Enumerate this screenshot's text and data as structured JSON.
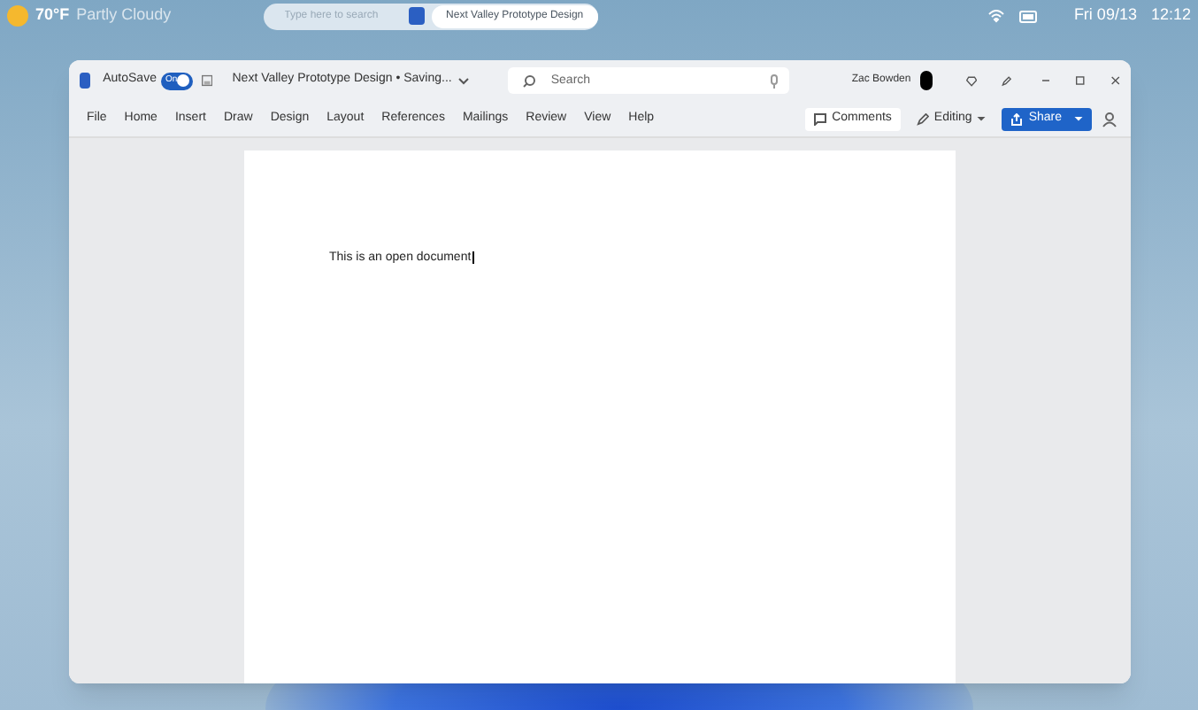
{
  "taskbar": {
    "temperature": "70°F",
    "weather": "Partly Cloudy",
    "search": {
      "placeholder": "Type here to search"
    },
    "open_document": "Next Valley Prototype Design",
    "date": "Fri 09/13",
    "time": "12:12"
  },
  "window": {
    "autosave_label": "AutoSave",
    "autosave": {
      "on": true,
      "label": "On"
    },
    "title": "Next Valley Prototype Design • Saving...",
    "search": {
      "placeholder": "Search"
    },
    "user": "Zac Bowden",
    "menu": [
      {
        "label": "File"
      },
      {
        "label": "Home"
      },
      {
        "label": "Insert"
      },
      {
        "label": "Draw"
      },
      {
        "label": "Design"
      },
      {
        "label": "Layout"
      },
      {
        "label": "References"
      },
      {
        "label": "Mailings"
      },
      {
        "label": "Review"
      },
      {
        "label": "View"
      },
      {
        "label": "Help"
      }
    ],
    "comments_button": "Comments",
    "editing_button": "Editing",
    "share_button": "Share"
  },
  "document": {
    "text": "This is an open document"
  }
}
